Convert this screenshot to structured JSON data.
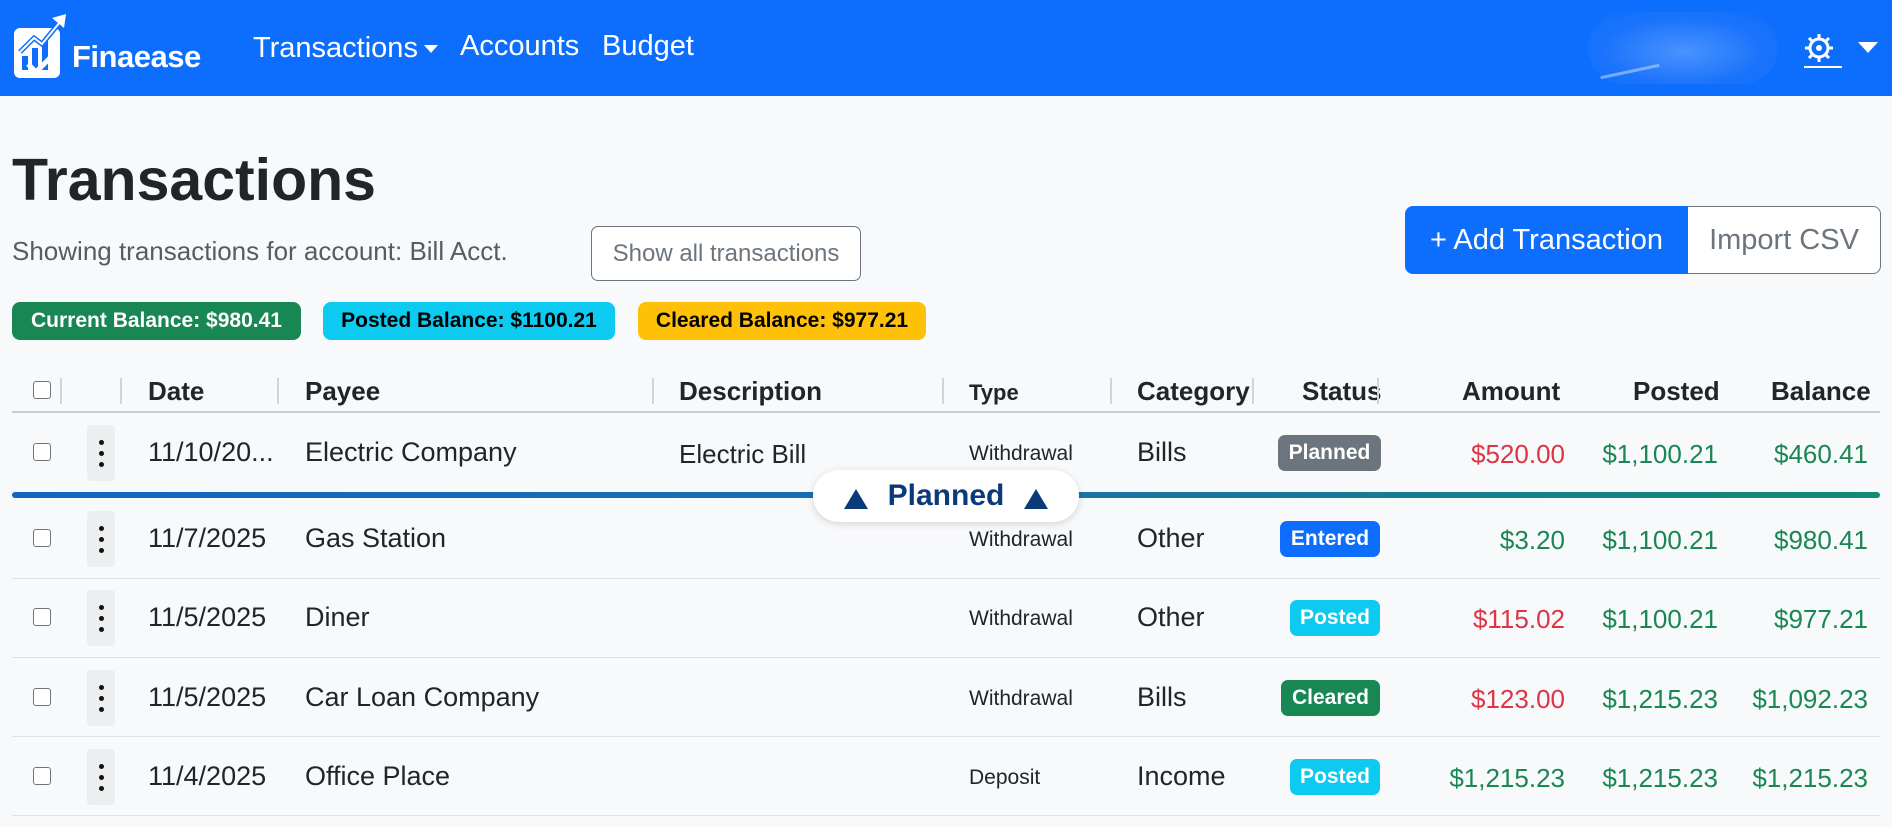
{
  "navbar": {
    "brand": "Finaease",
    "nav": [
      "Transactions",
      "Accounts",
      "Budget"
    ],
    "bg_color": "#0d6efd",
    "settings_icon": "gear-icon"
  },
  "page": {
    "title": "Transactions",
    "subtitle": "Showing transactions for account: Bill Acct.",
    "show_all_label": "Show all transactions",
    "add_label": "+ Add Transaction",
    "import_label": "Import CSV"
  },
  "balances": {
    "current": "Current Balance: $980.41",
    "posted": "Posted Balance: $1100.21",
    "cleared": "Cleared Balance: $977.21"
  },
  "table": {
    "headers": {
      "date": "Date",
      "payee": "Payee",
      "description": "Description",
      "type": "Type",
      "category": "Category",
      "status": "Status",
      "amount": "Amount",
      "posted": "Posted",
      "balance": "Balance"
    },
    "rows": [
      {
        "date": "11/10/20...",
        "payee": "Electric Company",
        "description": "Electric Bill",
        "type": "Withdrawal",
        "category": "Bills",
        "status": "Planned",
        "amount": "$520.00",
        "posted": "$1,100.21",
        "balance": "$460.41"
      },
      {
        "date": "11/7/2025",
        "payee": "Gas Station",
        "description": "",
        "type": "Withdrawal",
        "category": "Other",
        "status": "Entered",
        "amount": "$3.20",
        "posted": "$1,100.21",
        "balance": "$980.41"
      },
      {
        "date": "11/5/2025",
        "payee": "Diner",
        "description": "",
        "type": "Withdrawal",
        "category": "Other",
        "status": "Posted",
        "amount": "$115.02",
        "posted": "$1,100.21",
        "balance": "$977.21"
      },
      {
        "date": "11/5/2025",
        "payee": "Car Loan Company",
        "description": "",
        "type": "Withdrawal",
        "category": "Bills",
        "status": "Cleared",
        "amount": "$123.00",
        "posted": "$1,215.23",
        "balance": "$1,092.23"
      },
      {
        "date": "11/4/2025",
        "payee": "Office Place",
        "description": "",
        "type": "Deposit",
        "category": "Income",
        "status": "Posted",
        "amount": "$1,215.23",
        "posted": "$1,215.23",
        "balance": "$1,215.23"
      }
    ],
    "divider_label": "Planned"
  },
  "colors": {
    "negative": "#dc3545",
    "positive": "#198754",
    "status_planned": "#6c757d",
    "status_entered": "#0d6efd",
    "status_posted": "#0dcaf0",
    "status_cleared": "#198754"
  }
}
